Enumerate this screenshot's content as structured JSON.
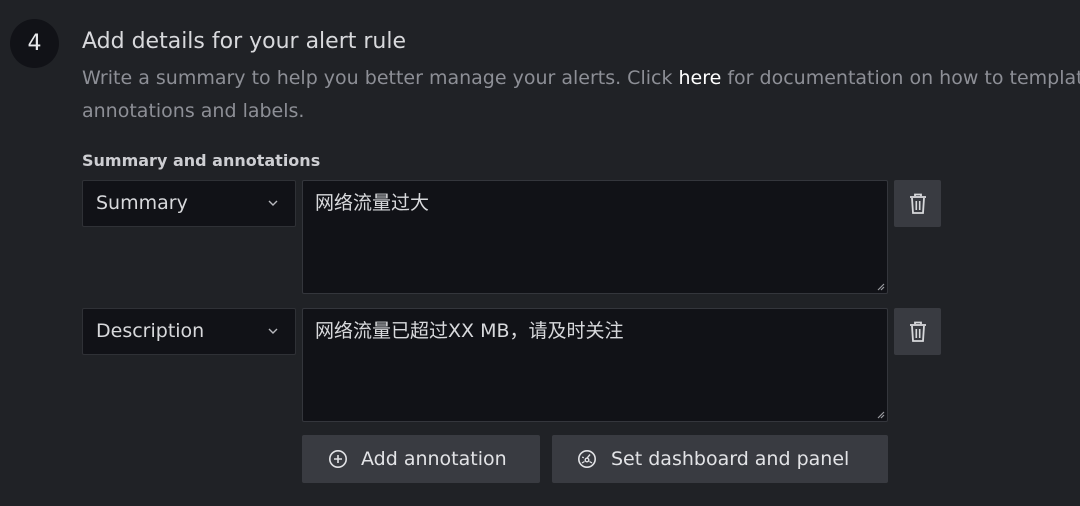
{
  "step": {
    "number": "4",
    "title": "Add details for your alert rule",
    "description_before": "Write a summary to help you better manage your alerts. Click ",
    "description_link": "here",
    "description_after": " for documentation on how to template annotations and labels."
  },
  "annotations": {
    "group_label": "Summary and annotations",
    "rows": [
      {
        "key": "Summary",
        "value": "网络流量过大"
      },
      {
        "key": "Description",
        "value": "网络流量已超过XX MB，请及时关注"
      }
    ]
  },
  "actions": {
    "add_annotation": "Add annotation",
    "set_dashboard": "Set dashboard and panel"
  },
  "colors": {
    "background": "#202226",
    "input_bg": "#111217",
    "button_bg": "#393b41",
    "muted_text": "#8d8f96"
  }
}
